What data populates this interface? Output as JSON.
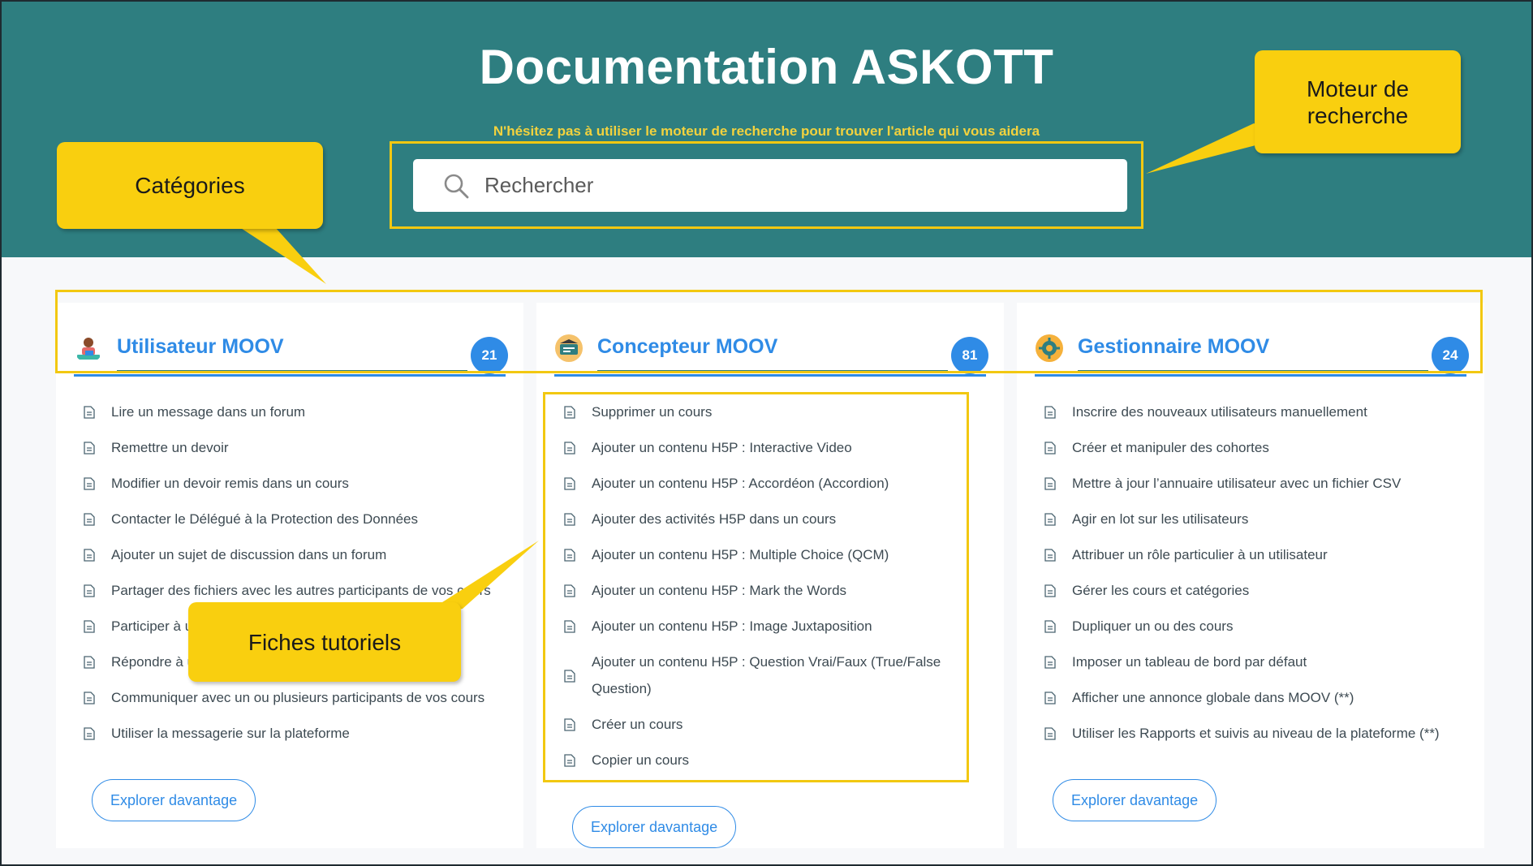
{
  "header": {
    "title": "Documentation ASKOTT",
    "subtitle": "N'hésitez pas à utiliser le moteur de recherche pour trouver l'article qui vous aidera",
    "search_placeholder": "Rechercher"
  },
  "colors": {
    "hero": "#2e7e80",
    "accent": "#2f8be6",
    "subtitle": "#f3d23d",
    "callout": "#f9cf0f"
  },
  "categories": [
    {
      "title": "Utilisateur MOOV",
      "count": "21",
      "icon": "user-laptop-icon",
      "button": "Explorer davantage",
      "items": [
        "Lire un message dans un forum",
        "Remettre un devoir",
        "Modifier un devoir remis dans un cours",
        "Contacter le Délégué à la Protection des Données",
        "Ajouter un sujet de discussion dans un forum",
        "Partager des fichiers avec les autres participants de vos cours",
        "Participer à un",
        "Répondre à un",
        "Communiquer avec un ou plusieurs participants de vos cours",
        "Utiliser la messagerie sur la plateforme"
      ]
    },
    {
      "title": "Concepteur MOOV",
      "count": "81",
      "icon": "designer-icon",
      "button": "Explorer davantage",
      "items": [
        "Supprimer un cours",
        "Ajouter un contenu H5P : Interactive Video",
        "Ajouter un contenu H5P : Accordéon (Accordion)",
        "Ajouter des activités H5P dans un cours",
        "Ajouter un contenu H5P : Multiple Choice (QCM)",
        "Ajouter un contenu H5P : Mark the Words",
        "Ajouter un contenu H5P : Image Juxtaposition",
        "Ajouter un contenu H5P : Question Vrai/Faux (True/False Question)",
        "Créer un cours",
        "Copier un cours"
      ]
    },
    {
      "title": "Gestionnaire MOOV",
      "count": "24",
      "icon": "manager-gear-icon",
      "button": "Explorer davantage",
      "items": [
        "Inscrire des nouveaux utilisateurs manuellement",
        "Créer et manipuler des cohortes",
        "Mettre à jour l’annuaire utilisateur avec un fichier CSV",
        "Agir en lot sur les utilisateurs",
        "Attribuer un rôle particulier à un utilisateur",
        "Gérer les cours et catégories",
        "Dupliquer un ou des cours",
        "Imposer un tableau de bord par défaut",
        "Afficher une annonce globale dans MOOV (**)",
        "Utiliser les Rapports et suivis au niveau de la plateforme (**)"
      ]
    }
  ],
  "annotations": {
    "search_engine": "Moteur de\nrecherche",
    "categories": "Catégories",
    "tutorials": "Fiches tutoriels"
  }
}
